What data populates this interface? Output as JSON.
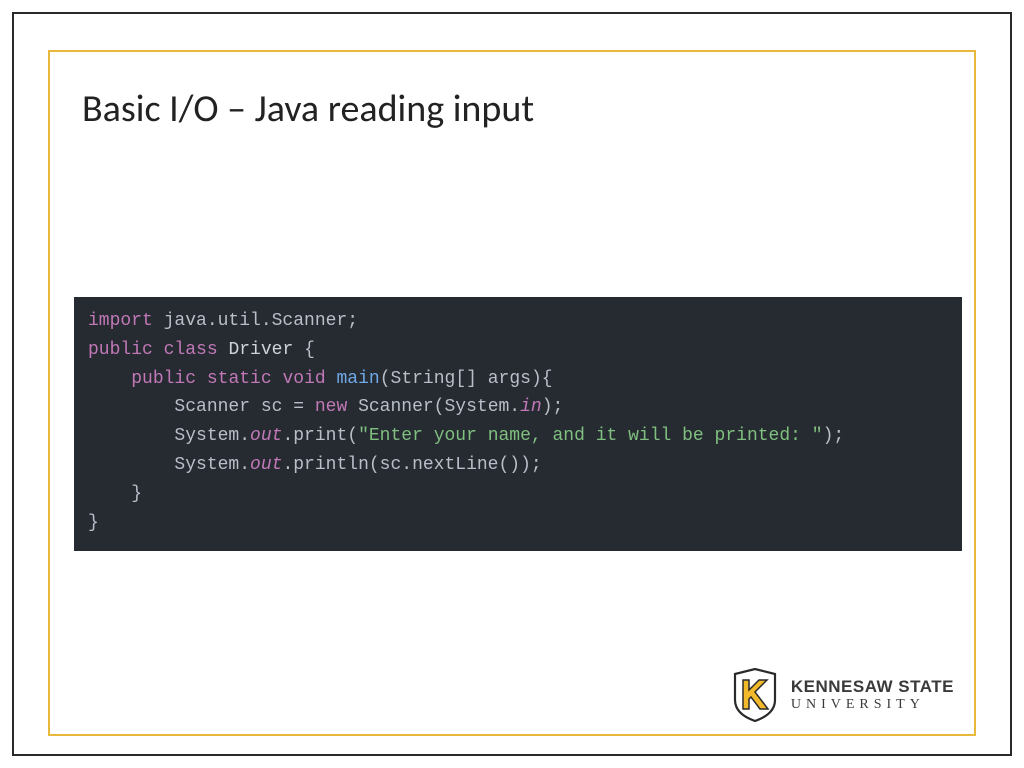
{
  "title": "Basic I/O – Java reading input",
  "code": {
    "l1": {
      "kw": "import",
      "rest": " java.util.Scanner;"
    },
    "l2": "",
    "l3": {
      "kw1": "public",
      "kw2": "class",
      "cls": "Driver",
      "rest": " {"
    },
    "l4": {
      "pad": "    ",
      "kw1": "public",
      "kw2": "static",
      "kw3": "void",
      "fn": "main",
      "rest": "(String[] args){"
    },
    "l5": {
      "pad": "        ",
      "lhs": "Scanner sc = ",
      "kw": "new",
      "mid": " Scanner(System.",
      "field": "in",
      "rest": ");"
    },
    "l6": {
      "pad": "        ",
      "lhs": "System.",
      "field": "out",
      "mid": ".print(",
      "str": "\"Enter your name, and it will be printed: \"",
      "rest": ");"
    },
    "l7": {
      "pad": "        ",
      "lhs": "System.",
      "field": "out",
      "rest": ".println(sc.nextLine());"
    },
    "l8": "    }",
    "l9": "}"
  },
  "footer": {
    "line1": "KENNESAW STATE",
    "line2": "UNIVERSITY"
  }
}
